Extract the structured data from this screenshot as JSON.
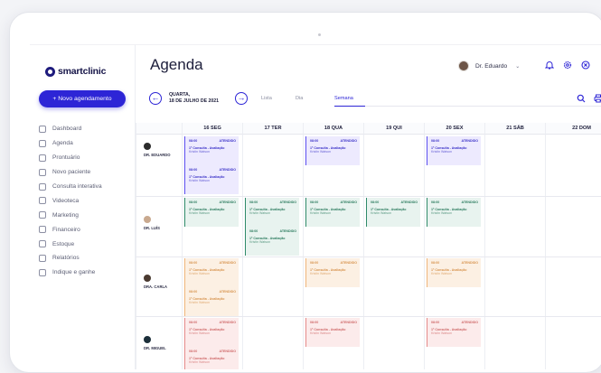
{
  "brand": {
    "name": "smartclinic"
  },
  "new_button": {
    "label": "+ Novo agendamento"
  },
  "nav": [
    {
      "label": "Dashboard",
      "icon": "home-icon"
    },
    {
      "label": "Agenda",
      "icon": "calendar-icon"
    },
    {
      "label": "Prontuário",
      "icon": "document-icon"
    },
    {
      "label": "Novo paciente",
      "icon": "user-plus-icon"
    },
    {
      "label": "Consulta interativa",
      "icon": "monitor-icon"
    },
    {
      "label": "Videoteca",
      "icon": "video-icon"
    },
    {
      "label": "Marketing",
      "icon": "send-icon"
    },
    {
      "label": "Financeiro",
      "icon": "dollar-icon"
    },
    {
      "label": "Estoque",
      "icon": "grid-icon"
    },
    {
      "label": "Relatórios",
      "icon": "clock-icon"
    },
    {
      "label": "Indique e ganhe",
      "icon": "users-icon"
    }
  ],
  "header": {
    "title": "Agenda",
    "user": "Dr. Eduardo"
  },
  "date": {
    "line1": "QUARTA,",
    "line2": "18 DE JULHO DE 2021"
  },
  "views": {
    "list": "Lista",
    "day": "Dia",
    "week": "Semana",
    "active": "Semana"
  },
  "days": [
    "16 SEG",
    "17 TER",
    "18 QUA",
    "19 QUI",
    "20 SEX",
    "21 SÁB",
    "22 DOM"
  ],
  "doctors": [
    {
      "name": "DR. EDUARDO",
      "color": "#2b2b2b"
    },
    {
      "name": "DR. LUÍS",
      "color": "#c9a98f"
    },
    {
      "name": "DRA. CARLA",
      "color": "#4a3a30"
    },
    {
      "name": "DR. MIGUEL",
      "color": "#1c2f3a"
    }
  ],
  "appointment": {
    "time": "08:00",
    "status": "ATENDIDO",
    "title": "1ª Consulta - Avaliação",
    "patient": "Kristin Watson"
  }
}
